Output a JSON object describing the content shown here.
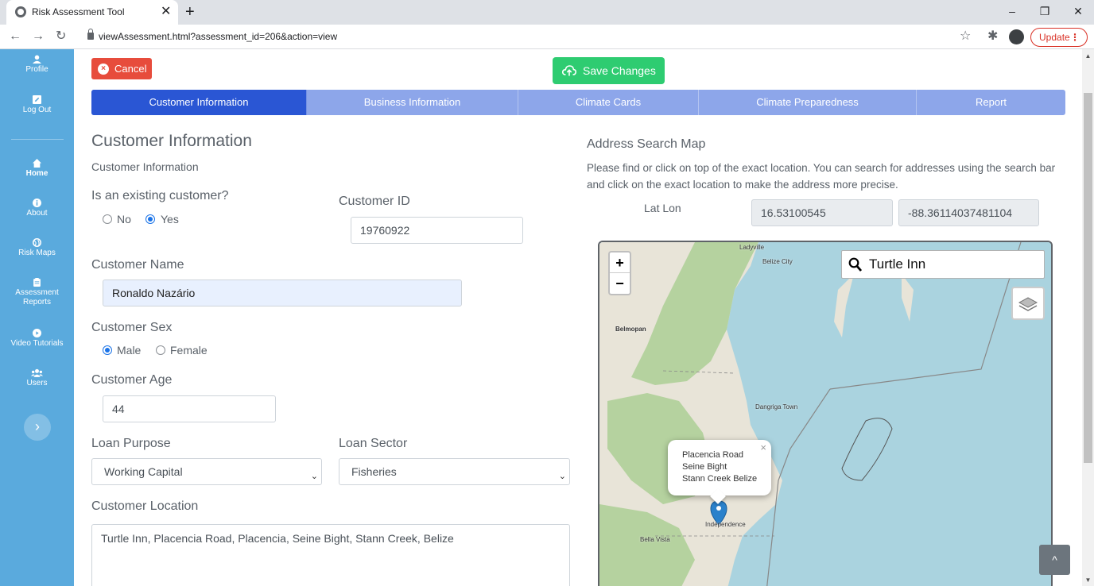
{
  "browser": {
    "tab_title": "Risk Assessment Tool",
    "tab_close": "✕",
    "new_tab": "+",
    "url": "viewAssessment.html?assessment_id=206&action=view",
    "update_label": "Update",
    "update_dots": "⋮",
    "minimize": "–",
    "restore": "❐",
    "close": "✕",
    "back": "←",
    "forward": "→",
    "reload": "↻",
    "star": "☆",
    "extensions": "✱"
  },
  "sidebar": {
    "items": [
      {
        "label": "Profile",
        "icon": "user-icon"
      },
      {
        "label": "Log Out",
        "icon": "edit-icon"
      },
      {
        "label": "Home",
        "icon": "home-icon"
      },
      {
        "label": "About",
        "icon": "info-icon"
      },
      {
        "label": "Risk Maps",
        "icon": "globe-icon"
      },
      {
        "label": "Assessment",
        "label2": "Reports",
        "icon": "clipboard-icon"
      },
      {
        "label": "Video Tutorials",
        "icon": "play-icon"
      },
      {
        "label": "Users",
        "icon": "users-icon"
      }
    ],
    "toggle": "›"
  },
  "actions": {
    "cancel_label": "Cancel",
    "cancel_icon": "×",
    "save_label": "Save Changes"
  },
  "tabs": [
    {
      "label": "Customer Information",
      "active": true
    },
    {
      "label": "Business Information",
      "active": false
    },
    {
      "label": "Climate Cards",
      "active": false
    },
    {
      "label": "Climate Preparedness",
      "active": false
    },
    {
      "label": "Report",
      "active": false
    }
  ],
  "form": {
    "title": "Customer Information",
    "subtitle": "Customer Information",
    "existing_label": "Is an existing customer?",
    "existing_options": [
      "No",
      "Yes"
    ],
    "existing_value": "Yes",
    "customer_id_label": "Customer ID",
    "customer_id_value": "19760922",
    "name_label": "Customer Name",
    "name_value": "Ronaldo Nazário",
    "sex_label": "Customer Sex",
    "sex_options": [
      "Male",
      "Female"
    ],
    "sex_value": "Male",
    "age_label": "Customer Age",
    "age_value": "44",
    "loan_purpose_label": "Loan Purpose",
    "loan_purpose_value": "Working Capital",
    "loan_sector_label": "Loan Sector",
    "loan_sector_value": "Fisheries",
    "location_label": "Customer Location",
    "location_value": "Turtle Inn, Placencia Road, Placencia, Seine Bight, Stann Creek, Belize",
    "chevron": "⌄"
  },
  "map_panel": {
    "title": "Address Search Map",
    "instructions": "Please find or click on top of the exact location. You can search for addresses using the search bar and click on the exact location to make the address more precise.",
    "latlon_label": "Lat Lon",
    "lat_value": "16.53100545",
    "lon_value": "-88.36114037481104",
    "search_value": "Turtle Inn",
    "zoom_in": "+",
    "zoom_out": "−",
    "popup_lines": [
      "Placencia Road",
      "Seine Bight",
      "Stann Creek Belize"
    ],
    "popup_close": "×",
    "place_labels": [
      "Ladyville",
      "Belize City",
      "Belmopan",
      "Dangriga Town",
      "Independence",
      "Bella Vista"
    ],
    "colors": {
      "sea": "#aad3df",
      "land": "#e8e4d8",
      "forest": "#b5d29f",
      "marker": "#2a81cb"
    }
  },
  "scroll_top": "^"
}
